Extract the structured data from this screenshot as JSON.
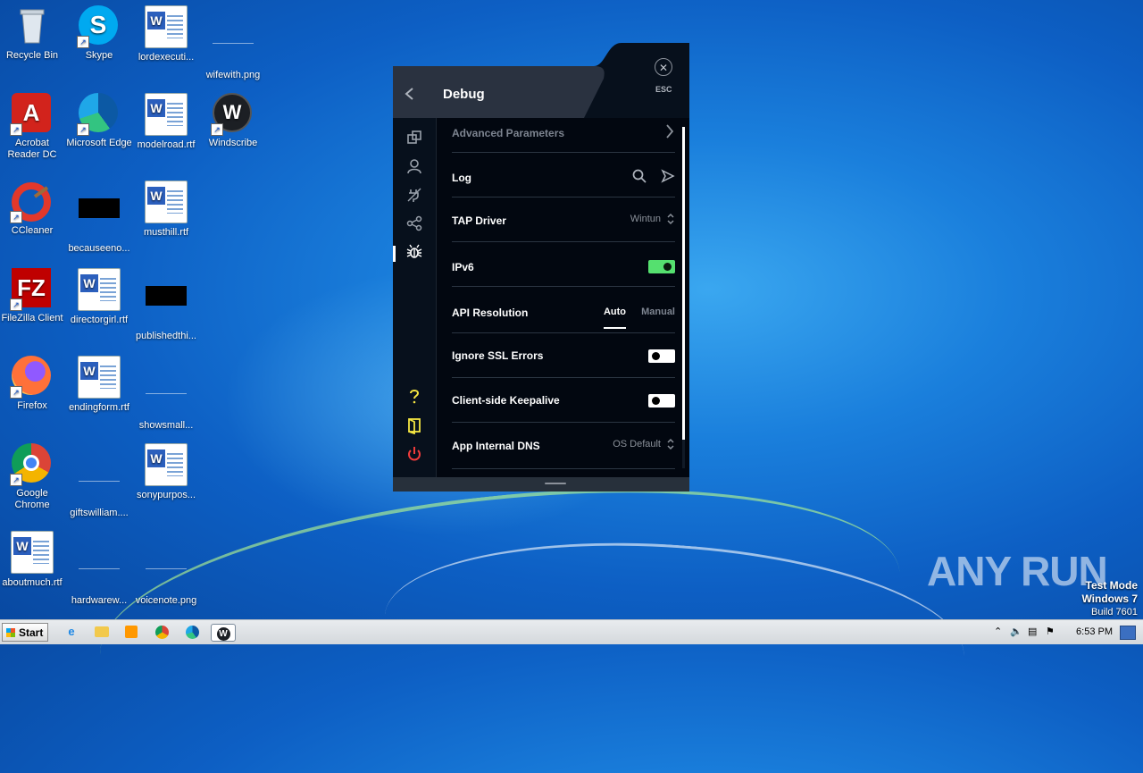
{
  "desktop": {
    "icons": [
      {
        "label": "Recycle Bin",
        "type": "recycle"
      },
      {
        "label": "Skype",
        "type": "skype"
      },
      {
        "label": "lordexecuti...",
        "type": "word"
      },
      {
        "label": "wifewith.png",
        "type": "png"
      },
      {
        "label": "Acrobat Reader DC",
        "type": "acrobat"
      },
      {
        "label": "Microsoft Edge",
        "type": "edge"
      },
      {
        "label": "modelroad.rtf",
        "type": "word"
      },
      {
        "label": "Windscribe",
        "type": "windscribe"
      },
      {
        "label": "CCleaner",
        "type": "ccleaner"
      },
      {
        "label": "becauseeno...",
        "type": "black"
      },
      {
        "label": "musthill.rtf",
        "type": "word"
      },
      {
        "label": "FileZilla Client",
        "type": "filezilla"
      },
      {
        "label": "directorgirl.rtf",
        "type": "word"
      },
      {
        "label": "publishedthi...",
        "type": "black"
      },
      {
        "label": "Firefox",
        "type": "firefox"
      },
      {
        "label": "endingform.rtf",
        "type": "word"
      },
      {
        "label": "showsmall...",
        "type": "png"
      },
      {
        "label": "Google Chrome",
        "type": "chrome"
      },
      {
        "label": "giftswilliam....",
        "type": "png"
      },
      {
        "label": "sonypurpos...",
        "type": "word"
      },
      {
        "label": "aboutmuch.rtf",
        "type": "word"
      },
      {
        "label": "hardwarew...",
        "type": "png"
      },
      {
        "label": "voicenote.png",
        "type": "png"
      }
    ]
  },
  "window": {
    "title": "Debug",
    "esc_label": "ESC",
    "rows": {
      "advanced": "Advanced Parameters",
      "log": "Log",
      "tap_driver": "TAP Driver",
      "tap_driver_value": "Wintun",
      "ipv6": "IPv6",
      "api_resolution": "API Resolution",
      "api_auto": "Auto",
      "api_manual": "Manual",
      "ignore_ssl": "Ignore SSL Errors",
      "keepalive": "Client-side Keepalive",
      "internal_dns": "App Internal DNS",
      "internal_dns_value": "OS Default"
    },
    "toggles": {
      "ipv6": true,
      "ignore_ssl": false,
      "keepalive": false
    },
    "colors": {
      "toggle_on": "#55e06f",
      "help": "#f5e642",
      "power": "#ef3b3b"
    }
  },
  "taskbar": {
    "start_label": "Start",
    "clock": "6:53 PM"
  },
  "watermark": "ANY RUN",
  "test_mode": {
    "line1": "Test Mode",
    "line2": "Windows 7",
    "line3": "Build 7601"
  }
}
